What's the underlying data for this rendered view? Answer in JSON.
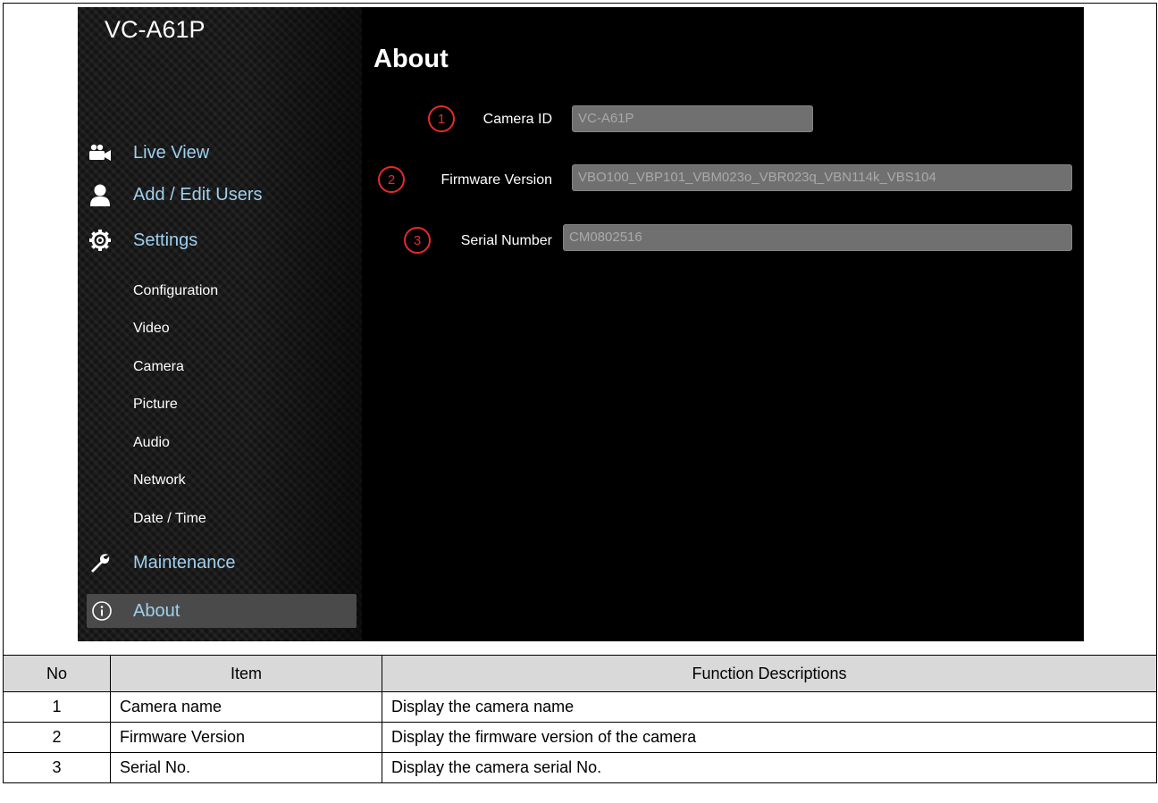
{
  "app": {
    "device_name": "VC-A61P",
    "page_title": "About"
  },
  "sidebar": {
    "nav": {
      "live_view": "Live View",
      "add_edit_users": "Add / Edit Users",
      "settings": "Settings",
      "maintenance": "Maintenance",
      "about": "About"
    },
    "settings_items": [
      "Configuration",
      "Video",
      "Camera",
      "Picture",
      "Audio",
      "Network",
      "Date / Time"
    ],
    "icons": {
      "live_view": "video-camera-icon",
      "add_edit_users": "user-icon",
      "settings": "gear-icon",
      "maintenance": "wrench-icon",
      "about": "info-icon"
    }
  },
  "fields": [
    {
      "number": "1",
      "label": "Camera ID",
      "value": "VC-A61P"
    },
    {
      "number": "2",
      "label": "Firmware Version",
      "value": "VBO100_VBP101_VBM023o_VBR023q_VBN114k_VBS104"
    },
    {
      "number": "3",
      "label": "Serial Number",
      "value": "CM0802516"
    }
  ],
  "table": {
    "headers": [
      "No",
      "Item",
      "Function Descriptions"
    ],
    "rows": [
      [
        "1",
        "Camera name",
        "Display the camera name"
      ],
      [
        "2",
        "Firmware Version",
        "Display the firmware version of the camera"
      ],
      [
        "3",
        "Serial No.",
        "Display the camera serial No."
      ]
    ]
  },
  "colors": {
    "nav_link": "#9fd0ee",
    "annotation_red": "#e62a2a",
    "selected_bg": "#4a4a4a",
    "input_bg": "#707070"
  }
}
